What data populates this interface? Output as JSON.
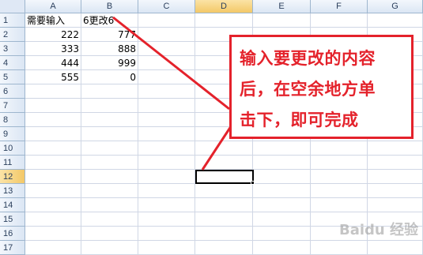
{
  "columns": [
    "A",
    "B",
    "C",
    "D",
    "E",
    "F",
    "G"
  ],
  "rows": [
    "1",
    "2",
    "3",
    "4",
    "5",
    "6",
    "7",
    "8",
    "9",
    "10",
    "11",
    "12",
    "13",
    "14",
    "15",
    "16",
    "17"
  ],
  "active_column": "D",
  "active_row": "12",
  "cells": {
    "A1": "需要输入",
    "B1": "6更改6",
    "A2": "222",
    "B2": "777",
    "A3": "333",
    "B3": "888",
    "A4": "444",
    "B4": "999",
    "A5": "555",
    "B5": "0"
  },
  "callout": {
    "lines": [
      "输入要更改的内容",
      "后，在空余地方单",
      "击下，即可完成"
    ],
    "color": "#e4222b"
  },
  "watermark": "Baidu 经验"
}
